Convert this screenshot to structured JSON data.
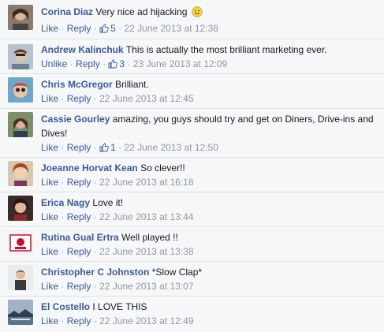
{
  "comments": [
    {
      "author": "Corina Diaz",
      "text": "Very nice ad hijacking",
      "emoji": "smiley-emoji",
      "action1": "Like",
      "action2": "Reply",
      "likes": "5",
      "time": "22 June 2013 at 12:38"
    },
    {
      "author": "Andrew Kalinchuk",
      "text": "This is actually the most brilliant marketing ever.",
      "action1": "Unlike",
      "action2": "Reply",
      "likes": "3",
      "time": "23 June 2013 at 12:09"
    },
    {
      "author": "Chris McGregor",
      "text": "Brilliant.",
      "action1": "Like",
      "action2": "Reply",
      "time": "22 June 2013 at 12:45"
    },
    {
      "author": "Cassie Gourley",
      "text": "amazing, you guys should try and get on Diners, Drive-ins and Dives!",
      "action1": "Like",
      "action2": "Reply",
      "likes": "1",
      "time": "22 June 2013 at 12:50"
    },
    {
      "author": "Joeanne Horvat Kean",
      "text": "So clever!!",
      "action1": "Like",
      "action2": "Reply",
      "time": "22 June 2013 at 16:18"
    },
    {
      "author": "Erica Nagy",
      "text": "Love it!",
      "action1": "Like",
      "action2": "Reply",
      "time": "22 June 2013 at 13:44"
    },
    {
      "author": "Rutina Gual Ertra",
      "text": "Well played !!",
      "action1": "Like",
      "action2": "Reply",
      "time": "22 June 2013 at 13:38"
    },
    {
      "author": "Christopher C Johnston",
      "text": "*Slow Clap*",
      "action1": "Like",
      "action2": "Reply",
      "time": "22 June 2013 at 13:07"
    },
    {
      "author": "El Costello",
      "text": "I LOVE THIS",
      "action1": "Like",
      "action2": "Reply",
      "time": "22 June 2013 at 12:49"
    }
  ],
  "separator": "·",
  "colors": {
    "link": "#3b5998",
    "meta": "#9197a3",
    "background": "#f6f7f9"
  }
}
